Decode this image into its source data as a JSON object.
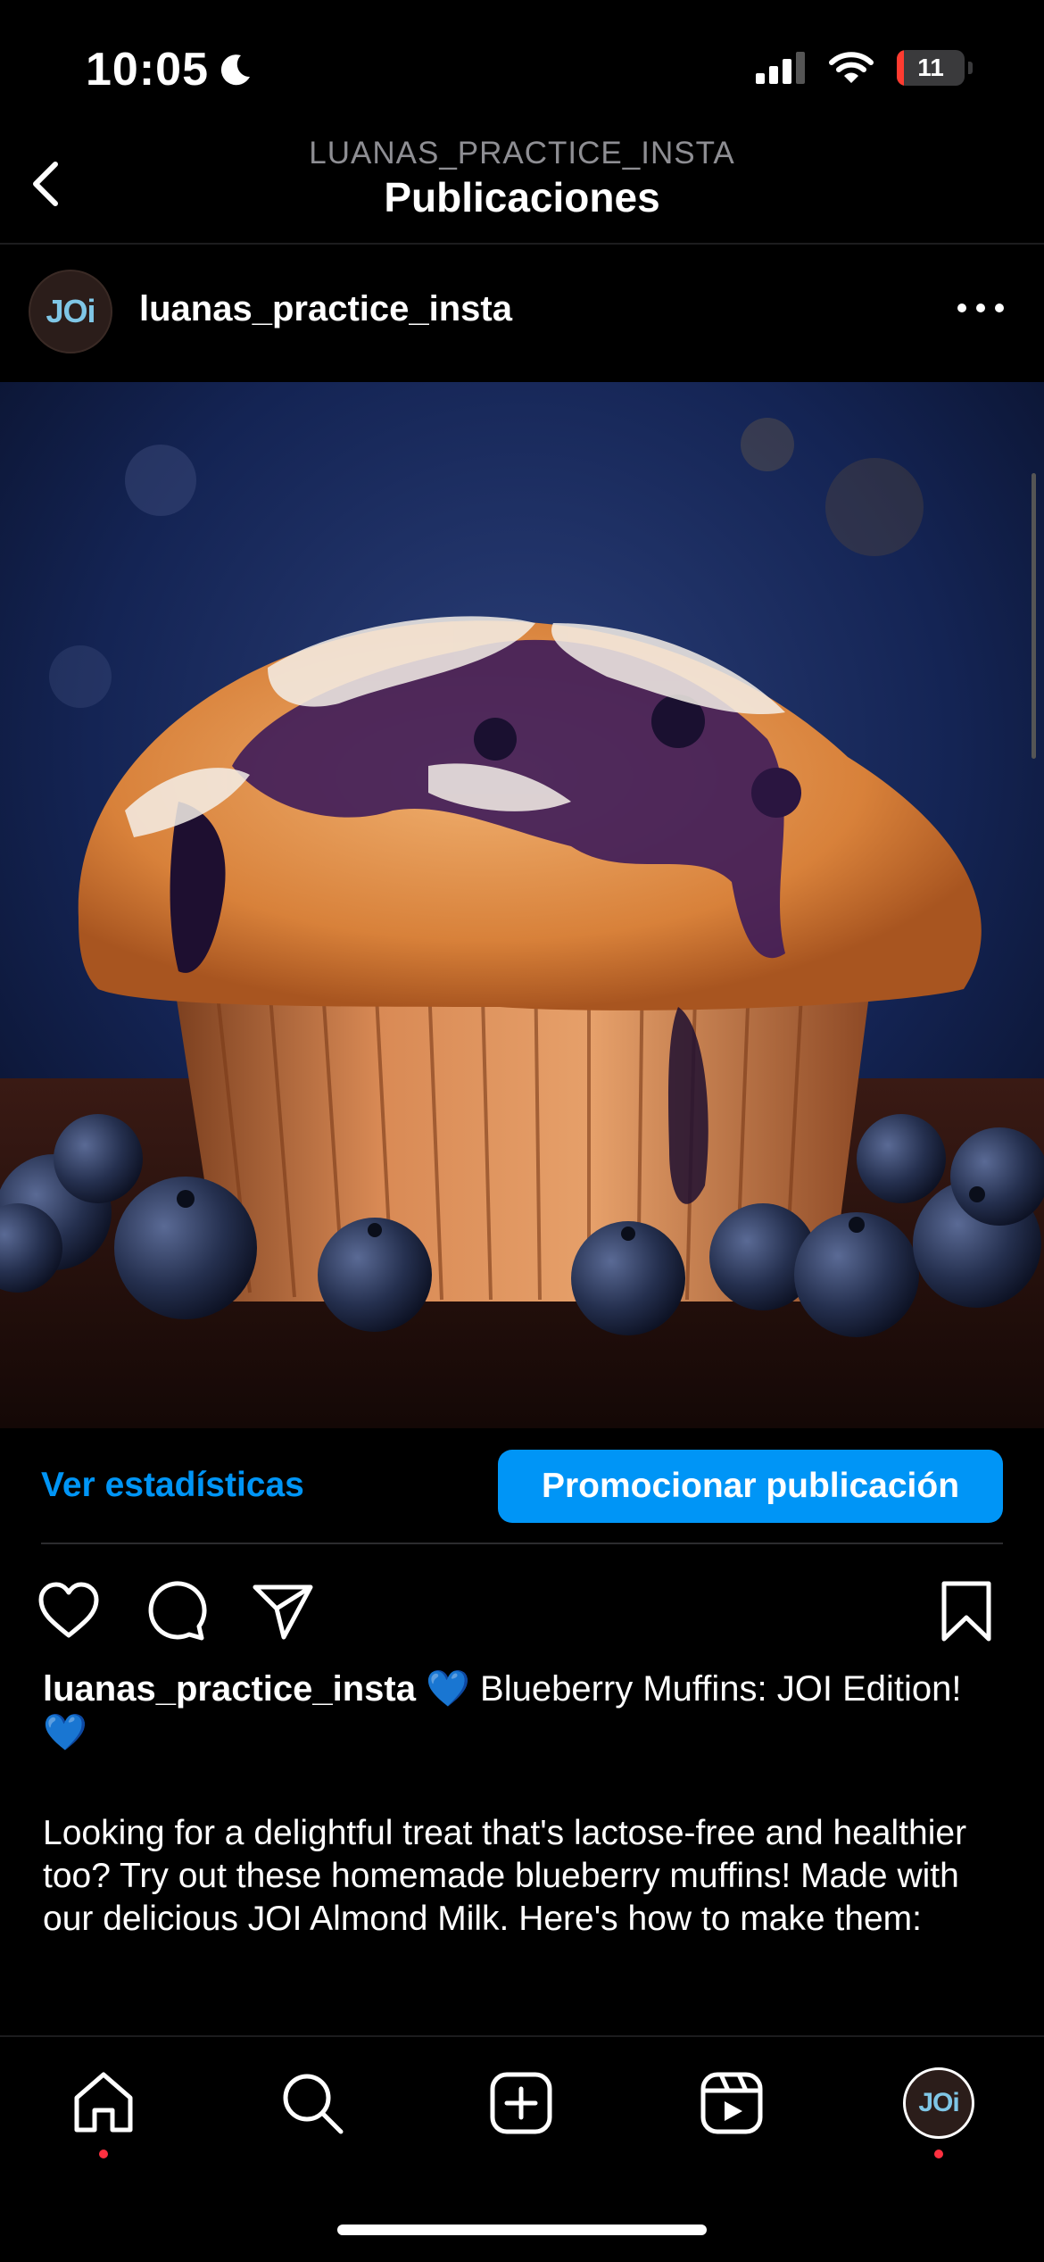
{
  "status": {
    "time": "10:05",
    "battery": "11",
    "battery_level": 0.11
  },
  "header": {
    "account": "LUANAS_PRACTICE_INSTA",
    "title": "Publicaciones"
  },
  "post": {
    "username": "luanas_practice_insta",
    "avatar_text": "JOi",
    "stats_label": "Ver estadísticas",
    "promote_label": "Promocionar publicación",
    "caption_username": "luanas_practice_insta",
    "caption_text": " 💙 Blueberry Muffins: JOI Edition! 💙",
    "body": "Looking for a delightful treat that's lactose-free and healthier too? Try out these homemade blueberry muffins! Made with our delicious JOI Almond Milk. Here's how to make them:"
  },
  "tabbar": {
    "profile_avatar_text": "JOi"
  },
  "colors": {
    "accent": "#0095f6",
    "notification": "#ff3040",
    "background": "#000000"
  }
}
